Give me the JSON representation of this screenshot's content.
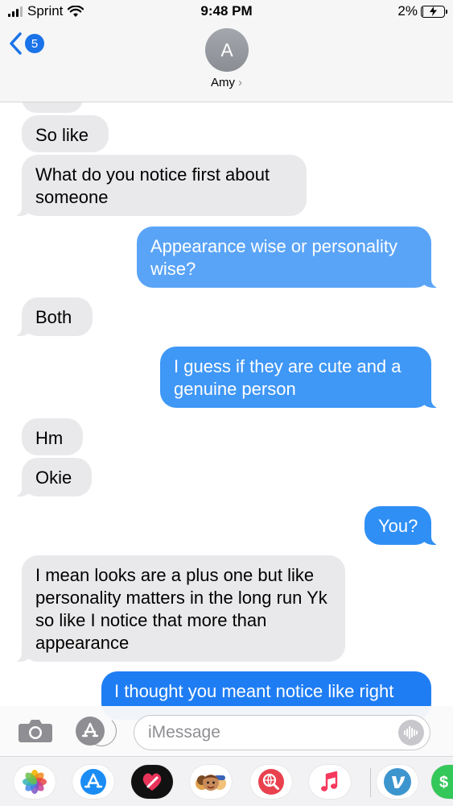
{
  "status_bar": {
    "carrier": "Sprint",
    "time": "9:48 PM",
    "battery_percent": "2%",
    "battery_level": 0.02,
    "signal_bars_filled": 3,
    "signal_bars_total": 4
  },
  "header": {
    "back_count": "5",
    "avatar_initial": "A",
    "contact_name": "Amy"
  },
  "messages": [
    {
      "direction": "incoming",
      "text": "So like"
    },
    {
      "direction": "incoming",
      "text": "What do you notice first about someone"
    },
    {
      "direction": "outgoing",
      "text": "Appearance wise or personality wise?"
    },
    {
      "direction": "incoming",
      "text": "Both"
    },
    {
      "direction": "outgoing",
      "text": "I guess if they are cute and a genuine person"
    },
    {
      "direction": "incoming",
      "text": "Hm"
    },
    {
      "direction": "incoming",
      "text": "Okie"
    },
    {
      "direction": "outgoing",
      "text": "You?"
    },
    {
      "direction": "incoming",
      "text": "I mean looks are a plus one but like personality matters in the long run Yk so like I notice that more than appearance"
    },
    {
      "direction": "outgoing",
      "text": "I thought you meant notice like right"
    }
  ],
  "composer": {
    "placeholder": "iMessage"
  },
  "app_drawer": [
    {
      "name": "Photos",
      "icon": "photos-icon"
    },
    {
      "name": "App Store",
      "icon": "app-store-icon"
    },
    {
      "name": "Digital Touch",
      "icon": "digital-touch-icon"
    },
    {
      "name": "Memoji",
      "icon": "memoji-icon"
    },
    {
      "name": "Images Search",
      "icon": "globe-search-icon"
    },
    {
      "name": "Music",
      "icon": "music-icon"
    },
    {
      "name": "Venmo",
      "icon": "venmo-icon"
    },
    {
      "name": "Apple Pay",
      "icon": "apple-pay-icon"
    }
  ],
  "colors": {
    "outgoing_bubble": "#2b8cf5",
    "incoming_bubble": "#e9e9eb",
    "accent": "#1a73e8"
  }
}
